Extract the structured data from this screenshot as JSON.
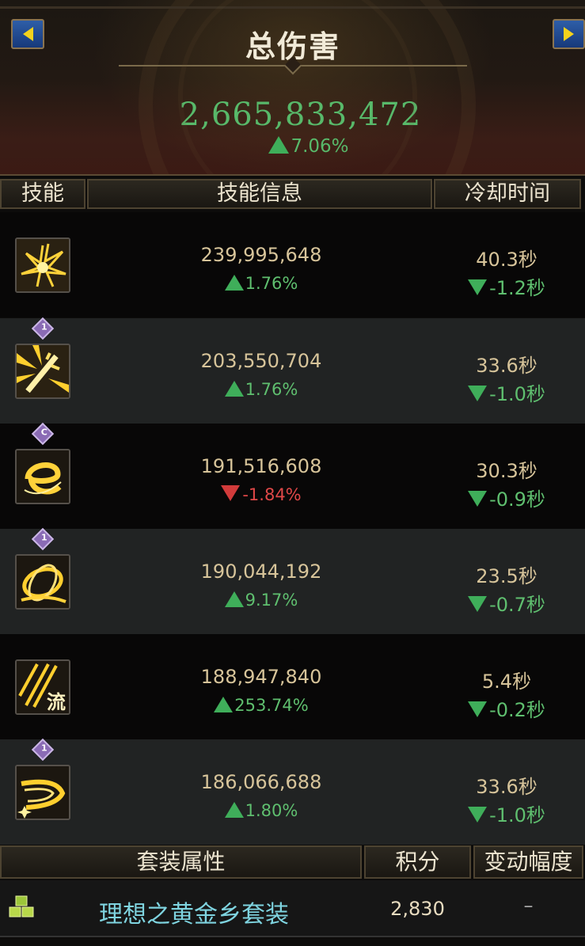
{
  "header": {
    "title": "总伤害",
    "total_damage": "2,665,833,472",
    "total_change": "7.06%"
  },
  "columns": {
    "skill": "技能",
    "info": "技能信息",
    "cooldown": "冷却时间"
  },
  "skills": [
    {
      "icon": "lightning-burst-icon",
      "badge": "",
      "damage": "239,995,648",
      "damage_change": "1.76%",
      "damage_trend": "up",
      "cooldown": "40.3秒",
      "cooldown_change": "-1.2秒"
    },
    {
      "icon": "sword-burst-icon",
      "badge": "1",
      "damage": "203,550,704",
      "damage_change": "1.76%",
      "damage_trend": "up",
      "cooldown": "33.6秒",
      "cooldown_change": "-1.0秒"
    },
    {
      "icon": "swirl-slash-icon",
      "badge": "C",
      "damage": "191,516,608",
      "damage_change": "-1.84%",
      "damage_trend": "down",
      "cooldown": "30.3秒",
      "cooldown_change": "-0.9秒"
    },
    {
      "icon": "spinning-ring-icon",
      "badge": "1",
      "damage": "190,044,192",
      "damage_change": "9.17%",
      "damage_trend": "up",
      "cooldown": "23.5秒",
      "cooldown_change": "-0.7秒"
    },
    {
      "icon": "flow-slash-icon",
      "badge": "",
      "damage": "188,947,840",
      "damage_change": "253.74%",
      "damage_trend": "up",
      "cooldown": "5.4秒",
      "cooldown_change": "-0.2秒"
    },
    {
      "icon": "crescent-wave-icon",
      "badge": "1",
      "damage": "186,066,688",
      "damage_change": "1.80%",
      "damage_trend": "up",
      "cooldown": "33.6秒",
      "cooldown_change": "-1.0秒"
    }
  ],
  "set_section": {
    "col_set": "套装属性",
    "col_score": "积分",
    "col_change": "变动幅度",
    "set_icon": "equipment-set-icon",
    "set_name": "理想之黄金乡套装",
    "score": "2,830",
    "change": "–"
  },
  "colors": {
    "positive": "#5fbf6f",
    "negative": "#e04848",
    "value_text": "#d7c49a",
    "set_name": "#7fd4e0"
  }
}
